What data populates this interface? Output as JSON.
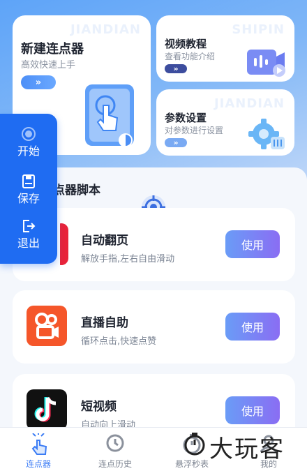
{
  "cards": {
    "new_clicker": {
      "title": "新建连点器",
      "subtitle": "高效快速上手",
      "watermark": "JIANDIAN",
      "arrow": "»"
    },
    "video_tutorial": {
      "title": "视频教程",
      "subtitle": "查看功能介绍",
      "watermark": "SHIPIN",
      "arrow": "»"
    },
    "settings": {
      "title": "参数设置",
      "subtitle": "对参数进行设置",
      "watermark": "JIANDIAN",
      "arrow": "»"
    }
  },
  "side_panel": {
    "start": "开始",
    "save": "保存",
    "exit": "退出"
  },
  "section_title": "点器脚本",
  "scripts": [
    {
      "title": "自动翻页",
      "subtitle": "解放手指,左右自由滑动",
      "button": "使用",
      "icon": "page-flip-app-icon"
    },
    {
      "title": "直播自助",
      "subtitle": "循环点击,快速点赞",
      "button": "使用",
      "icon": "kuaishou-app-icon"
    },
    {
      "title": "短视频",
      "subtitle": "自动向上滑动",
      "button": "使用",
      "icon": "douyin-app-icon"
    }
  ],
  "tabs": [
    {
      "label": "连点器",
      "icon": "tap-hand-icon",
      "active": true
    },
    {
      "label": "连点历史",
      "icon": "history-icon",
      "active": false
    },
    {
      "label": "悬浮秒表",
      "icon": "stopwatch-icon",
      "active": false
    },
    {
      "label": "我的",
      "icon": "profile-icon",
      "active": false
    }
  ],
  "watermark_text": "大玩客",
  "colors": {
    "accent": "#1f6cf2",
    "button_gradient_start": "#6a9cf7",
    "button_gradient_end": "#8a6df3",
    "active_tab": "#3b7cf5"
  }
}
